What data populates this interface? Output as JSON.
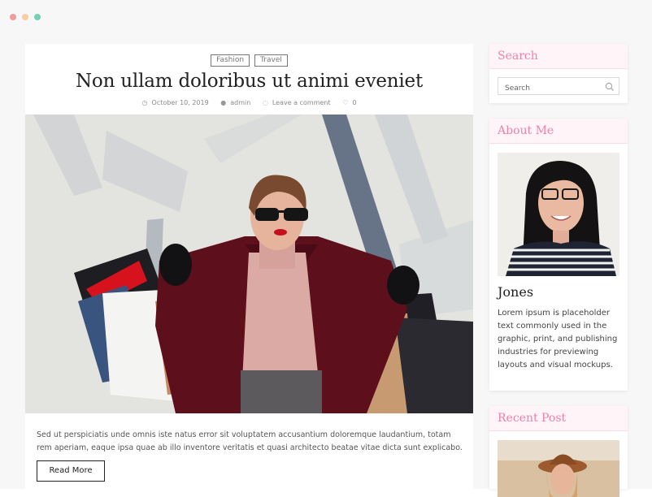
{
  "window": {
    "controls": [
      "close",
      "minimize",
      "maximize"
    ]
  },
  "post": {
    "categories": [
      "Fashion",
      "Travel"
    ],
    "title": "Non ullam doloribus ut animi eveniet",
    "meta": {
      "date": "October 10, 2019",
      "author": "admin",
      "comments": "Leave a comment",
      "likes": "0"
    },
    "excerpt": "Sed ut perspiciatis unde omnis iste natus error sit voluptatem accusantium doloremque laudantium, totam rem aperiam, eaque ipsa quae ab illo inventore veritatis et quasi architecto beatae vitae dicta sunt explicabo.",
    "read_more": "Read More"
  },
  "sidebar": {
    "search": {
      "title": "Search",
      "placeholder": "Search"
    },
    "about": {
      "title": "About Me",
      "name": "Jones",
      "text": "Lorem ipsum is placeholder text commonly used in the graphic, print, and publishing industries for previewing layouts and visual mockups."
    },
    "recent": {
      "title": "Recent Post"
    }
  },
  "colors": {
    "accent": "#f27fa8",
    "widget_header_bg": "#fff5f9",
    "dot_red": "#f39a9a",
    "dot_yellow": "#f6cfa0",
    "dot_green": "#75d0b2"
  },
  "icons": [
    "clock-icon",
    "user-icon",
    "comment-icon",
    "heart-icon",
    "search-icon"
  ]
}
